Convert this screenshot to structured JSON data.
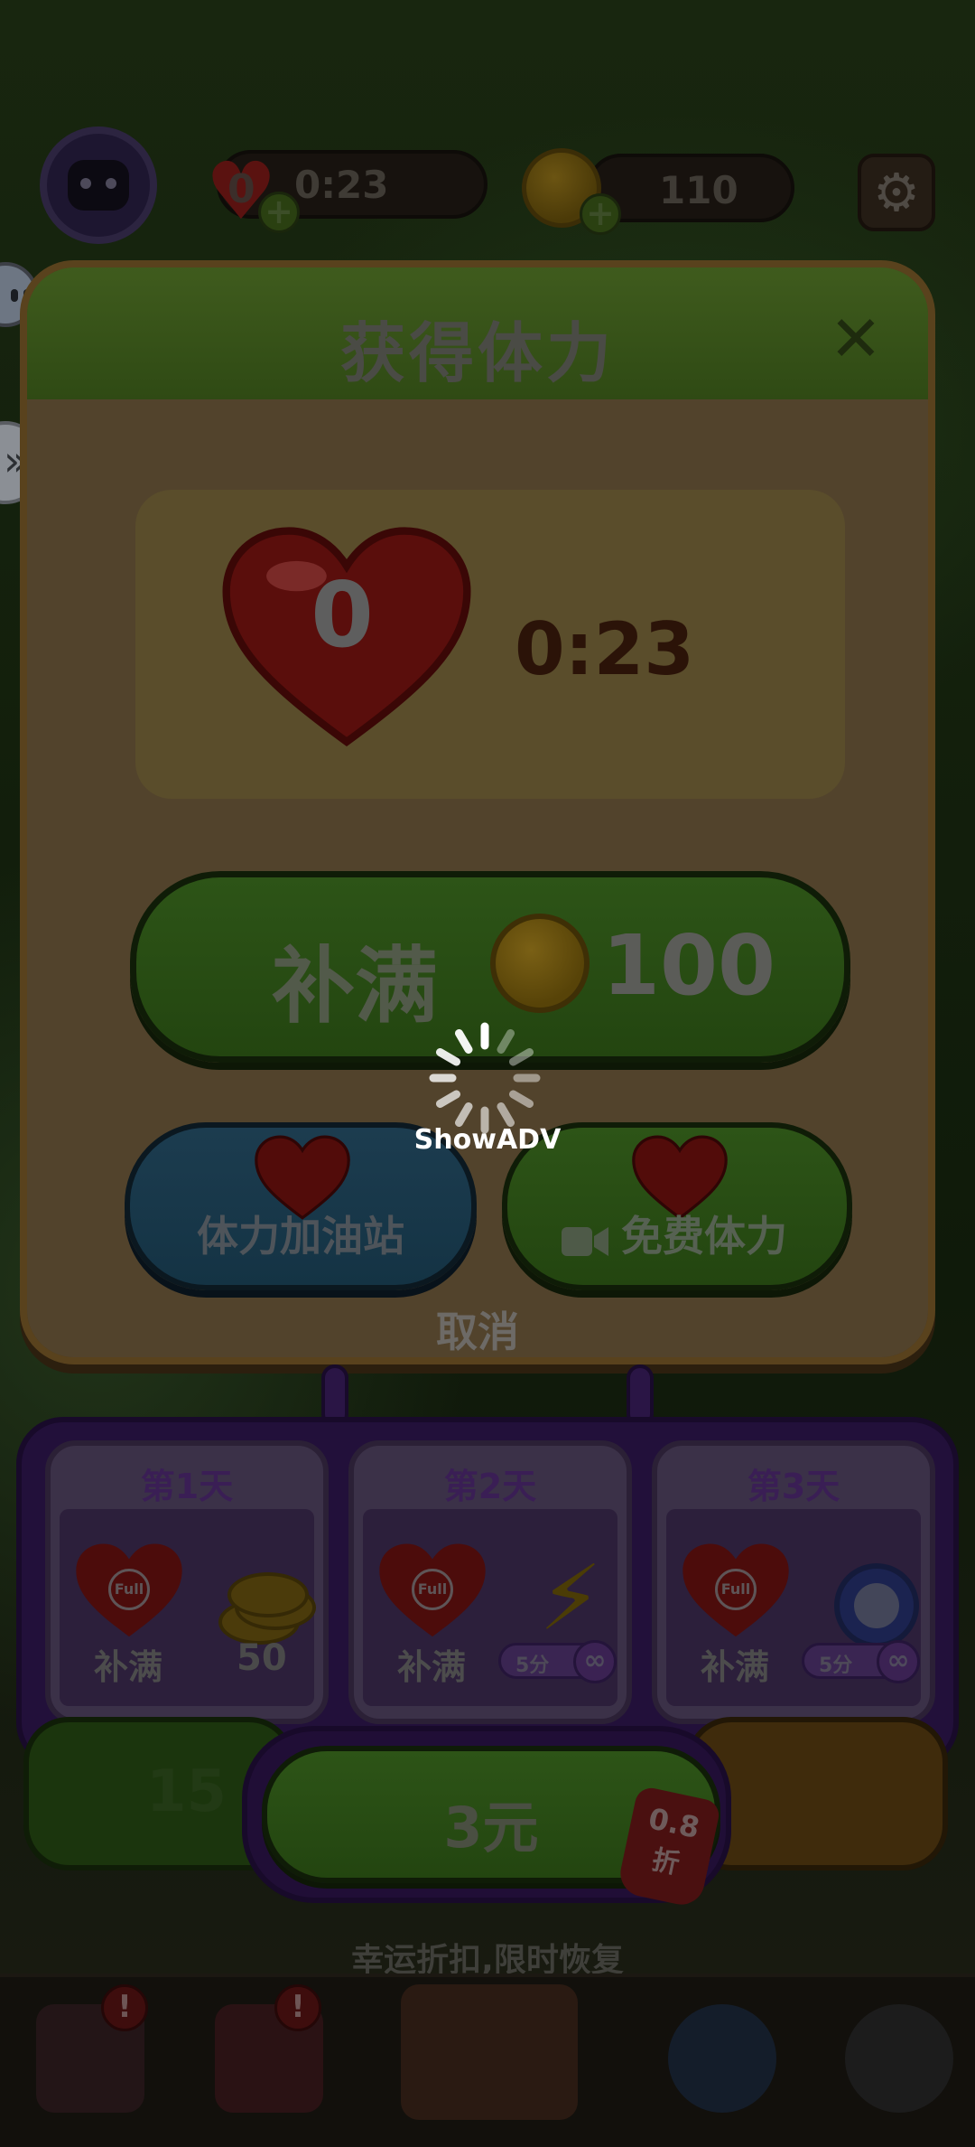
{
  "top_bar": {
    "lives": "0",
    "timer": "0:23",
    "coins": "110",
    "plus_symbol": "+",
    "gear_icon": "⚙"
  },
  "side_expand_icon": "»",
  "dialog": {
    "title": "获得体力",
    "close_icon": "✕",
    "lives_count": "0",
    "timer": "0:23",
    "refill_label": "补满",
    "refill_price": "100",
    "station_label": "体力加油站",
    "free_label": "免费体力",
    "cancel_label": "取消"
  },
  "daily_offer": {
    "days": [
      {
        "title": "第1天",
        "badge": "Full",
        "fill": "补满",
        "reward": "50"
      },
      {
        "title": "第2天",
        "badge": "Full",
        "fill": "补满",
        "reward_time": "5分",
        "reward_symbol": "∞"
      },
      {
        "title": "第3天",
        "badge": "Full",
        "fill": "补满",
        "reward_time": "5分",
        "reward_symbol": "∞"
      }
    ],
    "buy_price": "3元",
    "discount_value": "0.8",
    "discount_unit": "折",
    "lucky_text": "幸运折扣,限时恢复"
  },
  "background_button_text": "15",
  "loading": {
    "text": "ShowADV"
  },
  "bottom_nav": {
    "badge_symbol": "!"
  },
  "colors": {
    "loading_text": "#ffffff",
    "overlay_dim": "#000000"
  }
}
